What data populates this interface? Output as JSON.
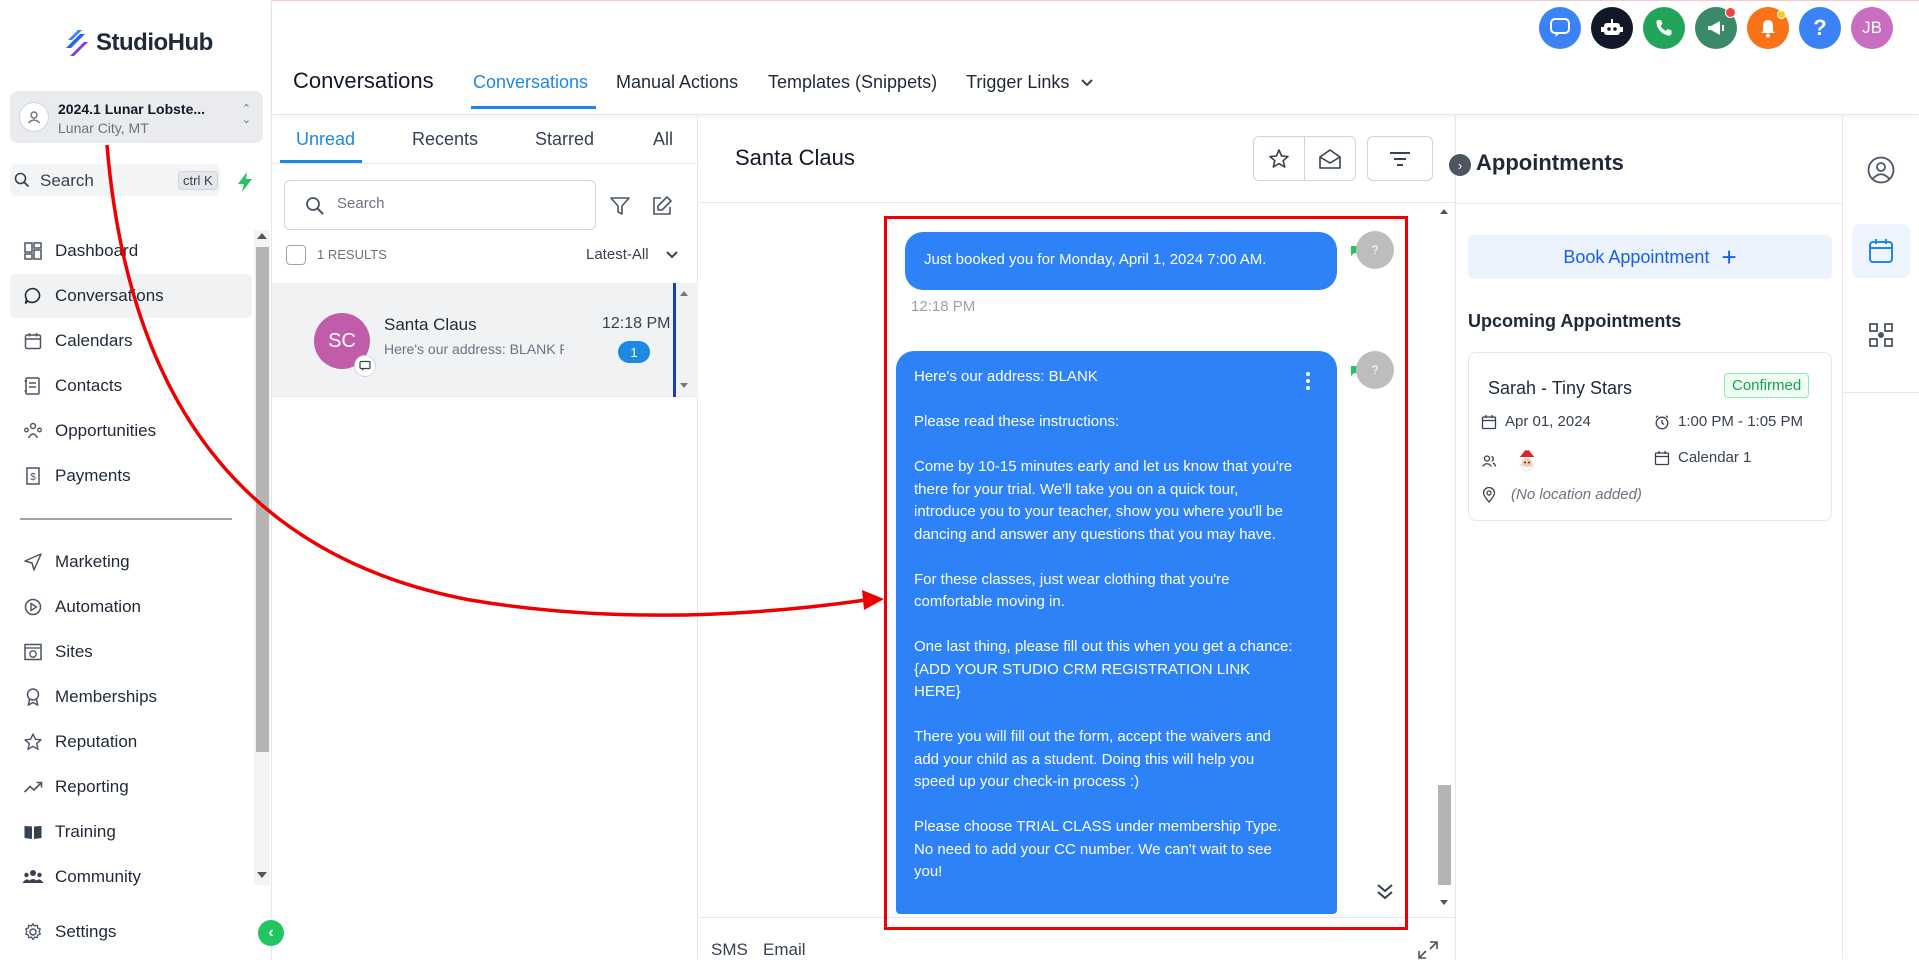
{
  "app": {
    "brand": "StudioHub",
    "accent": "#1e88e5",
    "brand_green": "#22c55e"
  },
  "location": {
    "name": "2024.1 Lunar Lobste...",
    "sub": "Lunar City, MT"
  },
  "search": {
    "label": "Search",
    "shortcut": "ctrl K"
  },
  "sidebar": {
    "items": [
      {
        "label": "Dashboard",
        "icon": "dashboard-icon"
      },
      {
        "label": "Conversations",
        "icon": "chat-bubble-icon",
        "active": true
      },
      {
        "label": "Calendars",
        "icon": "calendar-icon"
      },
      {
        "label": "Contacts",
        "icon": "contacts-icon"
      },
      {
        "label": "Opportunities",
        "icon": "opportunities-icon"
      },
      {
        "label": "Payments",
        "icon": "payments-icon"
      },
      {
        "label": "Marketing",
        "icon": "send-icon"
      },
      {
        "label": "Automation",
        "icon": "automation-icon"
      },
      {
        "label": "Sites",
        "icon": "globe-icon"
      },
      {
        "label": "Memberships",
        "icon": "badge-icon"
      },
      {
        "label": "Reputation",
        "icon": "star-icon"
      },
      {
        "label": "Reporting",
        "icon": "trend-icon"
      },
      {
        "label": "Training",
        "icon": "book-icon"
      },
      {
        "label": "Community",
        "icon": "group-icon"
      }
    ],
    "settings_label": "Settings"
  },
  "header": {
    "title": "Conversations",
    "tabs": [
      "Conversations",
      "Manual Actions",
      "Templates (Snippets)",
      "Trigger Links"
    ],
    "active_tab": "Conversations",
    "avatar_initials": "JB"
  },
  "list": {
    "tabs": [
      "Unread",
      "Recents",
      "Starred",
      "All"
    ],
    "active_tab": "Unread",
    "search_placeholder": "Search",
    "results": "1 RESULTS",
    "sort": "Latest-All",
    "conversations": [
      {
        "initials": "SC",
        "name": "Santa Claus",
        "preview": "Here's our address: BLANK Please read these instructions",
        "time": "12:18 PM",
        "unread": "1"
      }
    ]
  },
  "chat": {
    "contact": "Santa Claus",
    "messages": [
      {
        "text": "Just booked you for Monday, April 1, 2024 7:00 AM.",
        "time": "12:18 PM"
      },
      {
        "paragraphs": [
          "Here's our address: BLANK",
          "Please read these instructions:",
          "Come by 10-15 minutes early and let us know that you're there for your trial. We'll take you on a quick tour, introduce you to your teacher, show you where you'll be dancing and answer any questions that you may have.",
          "For these classes, just wear clothing that you're comfortable moving in.",
          "One last thing, please fill out this when you get a chance: {ADD YOUR STUDIO CRM REGISTRATION LINK HERE}",
          "There you will fill out the form, accept the waivers and add your child as a student. Doing this will help you speed up your check-in process :)",
          "Please choose TRIAL CLASS under membership Type. No need to add your CC number. We can't wait to see you!"
        ]
      }
    ],
    "avatar_glyph": "?",
    "channels": [
      "SMS",
      "Email"
    ]
  },
  "appointments": {
    "title": "Appointments",
    "book_label": "Book Appointment",
    "upcoming_label": "Upcoming Appointments",
    "items": [
      {
        "name": "Sarah - Tiny Stars",
        "status": "Confirmed",
        "date": "Apr 01, 2024",
        "time": "1:00 PM - 1:05 PM",
        "calendar": "Calendar 1",
        "location": "(No location added)"
      }
    ]
  }
}
